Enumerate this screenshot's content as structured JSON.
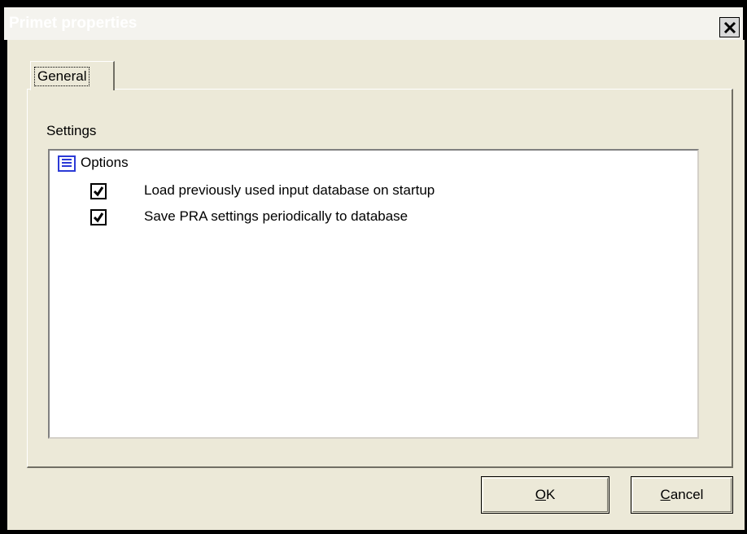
{
  "window": {
    "title": "Primet properties",
    "close_symbol": "×",
    "title_color": "#ffffff",
    "close_icon": "close-icon"
  },
  "tabs": [
    {
      "label": "General",
      "selected": true
    }
  ],
  "settings": {
    "group_label": "Settings",
    "root": {
      "label": "Options",
      "icon": "list-document-icon"
    },
    "items": [
      {
        "label": "Load previously used input database on startup",
        "checked": true
      },
      {
        "label": "Save PRA settings periodically to database",
        "checked": true
      }
    ]
  },
  "buttons": {
    "ok": {
      "mnemonic": "O",
      "rest": "K"
    },
    "cancel": {
      "mnemonic": "C",
      "rest": "ancel"
    }
  },
  "colors": {
    "face": "#ece9d8",
    "icon_blue": "#2b3ad6"
  }
}
